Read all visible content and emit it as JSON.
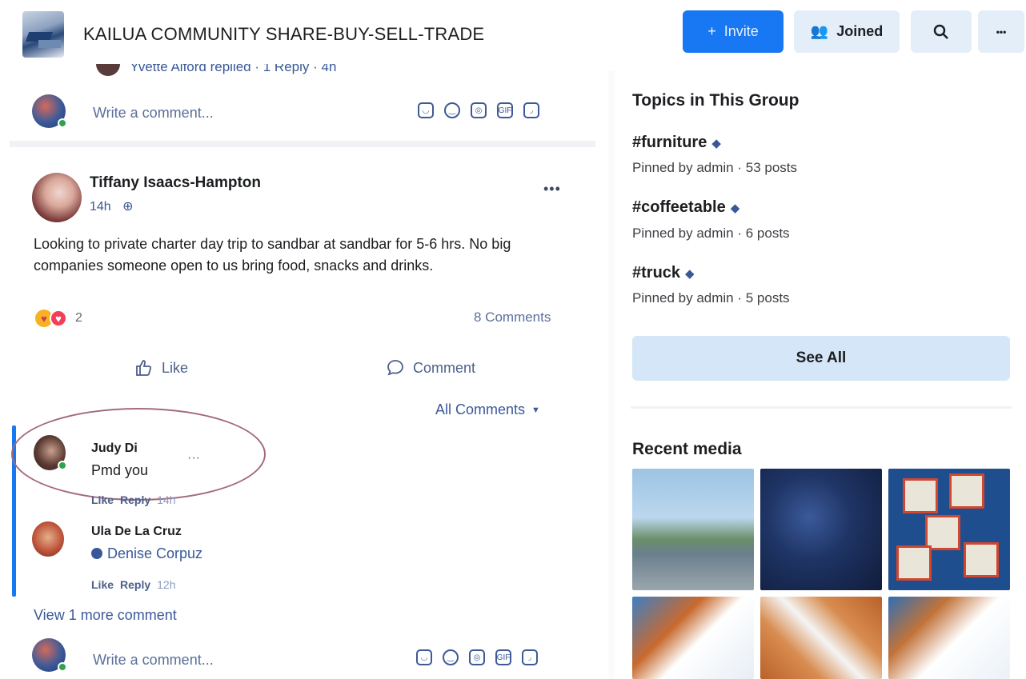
{
  "header": {
    "group_title": "KAILUA COMMUNITY SHARE-BUY-SELL-TRADE",
    "invite_label": "Invite",
    "joined_label": "Joined",
    "search_glyph": "🔍",
    "more_glyph": "•••"
  },
  "feed": {
    "partial_reply_text": "Yvette Alford replied · 1 Reply · 4h",
    "top_comment_placeholder": "Write a comment...",
    "post": {
      "author": "Tiffany Isaacs-Hampton",
      "time": "14h",
      "privacy_icon": "globe-icon",
      "text": "Looking to private charter day trip to sandbar at sandbar for 5-6 hrs. No big companies someone open to us bring food, snacks and drinks.",
      "reaction_count": "2",
      "comments_count": "8 Comments",
      "like_label": "Like",
      "comment_label": "Comment",
      "filter_label": "All Comments"
    },
    "comments": [
      {
        "name": "Judy Di",
        "text": "Pmd you",
        "like": "Like",
        "reply": "Reply",
        "time": "14h"
      },
      {
        "name": "Ula De La Cruz",
        "mention": "Denise Corpuz",
        "like": "Like",
        "reply": "Reply",
        "time": "12h"
      }
    ],
    "view_more": "View 1 more comment",
    "bottom_comment_placeholder": "Write a comment..."
  },
  "sidebar": {
    "topics_title": "Topics in This Group",
    "topics": [
      {
        "tag": "#furniture",
        "meta": "Pinned by admin · 53 posts"
      },
      {
        "tag": "#coffeetable",
        "meta": "Pinned by admin · 6 posts"
      },
      {
        "tag": "#truck",
        "meta": "Pinned by admin · 5 posts"
      }
    ],
    "see_all_label": "See All",
    "recent_media_title": "Recent media"
  },
  "colors": {
    "accent": "#1877f2",
    "link": "#385898",
    "button_light": "#e4eef9",
    "online": "#31a24c"
  }
}
